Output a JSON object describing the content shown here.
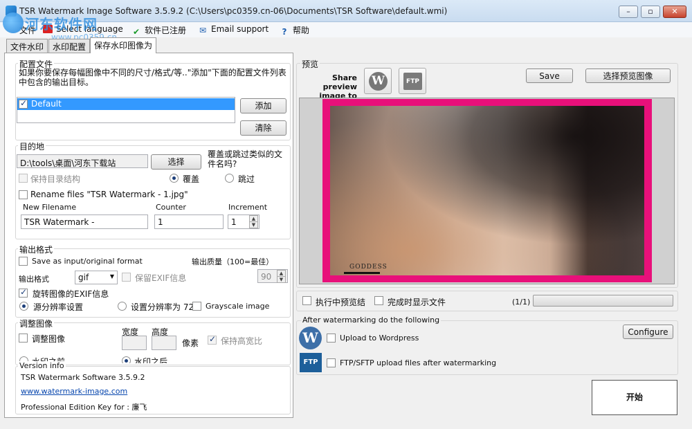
{
  "window": {
    "title": "TSR Watermark Image Software 3.5.9.2 (C:\\Users\\pc0359.cn-06\\Documents\\TSR Software\\default.wmi)",
    "min": "▭",
    "max": "▭",
    "close": "✕"
  },
  "menu": {
    "file": "文件",
    "select_language": "Select language",
    "registered": "软件已注册",
    "email_support": "Email support",
    "help": "帮助"
  },
  "overlay_watermark": {
    "site_name": "河东软件网",
    "url": "www.pc0359.cn"
  },
  "tabs": [
    "文件水印",
    "水印配置",
    "保存水印图像为"
  ],
  "config": {
    "title": "配置文件",
    "description": "如果你要保存每幅图像中不同的尺寸/格式/等..\"添加\"下面的配置文件列表中包含的输出目标。",
    "list_items": [
      {
        "label": "Default",
        "checked": true
      }
    ],
    "add_button": "添加",
    "clear_button": "清除"
  },
  "destination": {
    "title": "目的地",
    "path": "D:\\tools\\桌面\\河东下载站",
    "choose_button": "选择",
    "overwrite_question": "覆盖或跳过类似的文件名吗?",
    "keep_structure": "保持目录结构",
    "overwrite": "覆盖",
    "skip": "跳过",
    "rename_files": "Rename files \"TSR Watermark - 1.jpg\"",
    "new_filename_label": "New Filename",
    "new_filename_value": "TSR Watermark -",
    "counter_label": "Counter",
    "counter_value": "1",
    "increment_label": "Increment",
    "increment_value": "1"
  },
  "output_format": {
    "title": "输出格式",
    "save_as_input": "Save as input/original format",
    "quality_label": "输出质量（100=最佳）",
    "format_label": "输出格式",
    "format_value": "gif",
    "keep_exif": "保留EXIF信息",
    "quality_value": "90",
    "rotate_exif": "旋转图像的EXIF信息",
    "source_resolution": "源分辨率设置",
    "set_resolution": "设置分辨率为 72",
    "grayscale": "Grayscale image"
  },
  "resize": {
    "title": "调整图像",
    "resize_image": "调整图像",
    "width_label": "宽度",
    "height_label": "高度",
    "pixels": "像素",
    "keep_aspect": "保持高宽比",
    "before_watermark": "水印之前",
    "after_watermark": "水印之后"
  },
  "version": {
    "title": "Version info",
    "version_text": "TSR Watermark Software 3.5.9.2",
    "website": "www.watermark-image.com",
    "key_text": "Professional Edition Key for : 廉飞"
  },
  "preview": {
    "title": "预览",
    "share_label": "Share preview image to",
    "ftp_icon_text": "FTP",
    "wp_icon_text": "W",
    "save_button": "Save",
    "select_preview_button": "选择预览图像",
    "photo_watermark_text": "GODDESS",
    "preview_during": "执行中预览结",
    "show_file_done": "完成时显示文件",
    "page_counter": "(1/1)",
    "progress": 0
  },
  "after": {
    "title": "After watermarking do the following",
    "upload_wordpress": "Upload to Wordpress",
    "ftp_upload": "FTP/SFTP upload files after watermarking",
    "configure_button": "Configure",
    "ftp_icon_text": "FTP",
    "wp_icon_text": "W"
  },
  "start_button": "开始",
  "colors": {
    "preview_frame": "#e8107a",
    "title_bar": "#c9dcf0",
    "link": "#0645ad"
  }
}
